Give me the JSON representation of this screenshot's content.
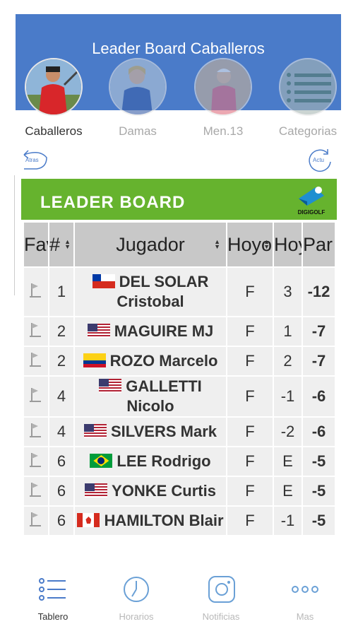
{
  "header": {
    "title": "Leader Board Caballeros"
  },
  "categories": [
    {
      "label": "Caballeros",
      "icon": "golfer-man-photo"
    },
    {
      "label": "Damas",
      "icon": "golfer-woman-photo"
    },
    {
      "label": "Men.13",
      "icon": "junior-golfer-photo"
    },
    {
      "label": "Categorias",
      "icon": "list-icon"
    }
  ],
  "nav": {
    "back_label": "Atras",
    "refresh_label": "Actu"
  },
  "leaderboard": {
    "title": "LEADER BOARD",
    "logo_text": "DIGIGOLF",
    "columns": [
      "Fav",
      "#",
      "Jugador",
      "Hoyo",
      "Hoy",
      "Par"
    ],
    "rows": [
      {
        "pos": "1",
        "flag": "chile",
        "last": "DEL SOLAR",
        "first": "Cristobal",
        "hoyo": "F",
        "hoy": "3",
        "par": "-12"
      },
      {
        "pos": "2",
        "flag": "usa",
        "last": "MAGUIRE",
        "first": "MJ",
        "hoyo": "F",
        "hoy": "1",
        "par": "-7"
      },
      {
        "pos": "2",
        "flag": "colombia",
        "last": "ROZO",
        "first": "Marcelo",
        "hoyo": "F",
        "hoy": "2",
        "par": "-7"
      },
      {
        "pos": "4",
        "flag": "usa",
        "last": "GALLETTI",
        "first": "Nicolo",
        "hoyo": "F",
        "hoy": "-1",
        "par": "-6"
      },
      {
        "pos": "4",
        "flag": "usa",
        "last": "SILVERS",
        "first": "Mark",
        "hoyo": "F",
        "hoy": "-2",
        "par": "-6"
      },
      {
        "pos": "6",
        "flag": "brazil",
        "last": "LEE",
        "first": "Rodrigo",
        "hoyo": "F",
        "hoy": "E",
        "par": "-5"
      },
      {
        "pos": "6",
        "flag": "usa",
        "last": "YONKE",
        "first": "Curtis",
        "hoyo": "F",
        "hoy": "E",
        "par": "-5"
      },
      {
        "pos": "6",
        "flag": "canada",
        "last": "HAMILTON",
        "first": "Blair",
        "hoyo": "F",
        "hoy": "-1",
        "par": "-5"
      }
    ]
  },
  "bottom_nav": [
    {
      "label": "Tablero",
      "icon": "list-icon",
      "active": true
    },
    {
      "label": "Horarios",
      "icon": "clock-icon",
      "active": false
    },
    {
      "label": "Notificias",
      "icon": "instagram-icon",
      "active": false
    },
    {
      "label": "Mas",
      "icon": "more-icon",
      "active": false
    }
  ],
  "colors": {
    "header": "#4a7bc9",
    "banner": "#66b32e",
    "name": "#3d6e1a",
    "negative": "#e01b1b"
  }
}
